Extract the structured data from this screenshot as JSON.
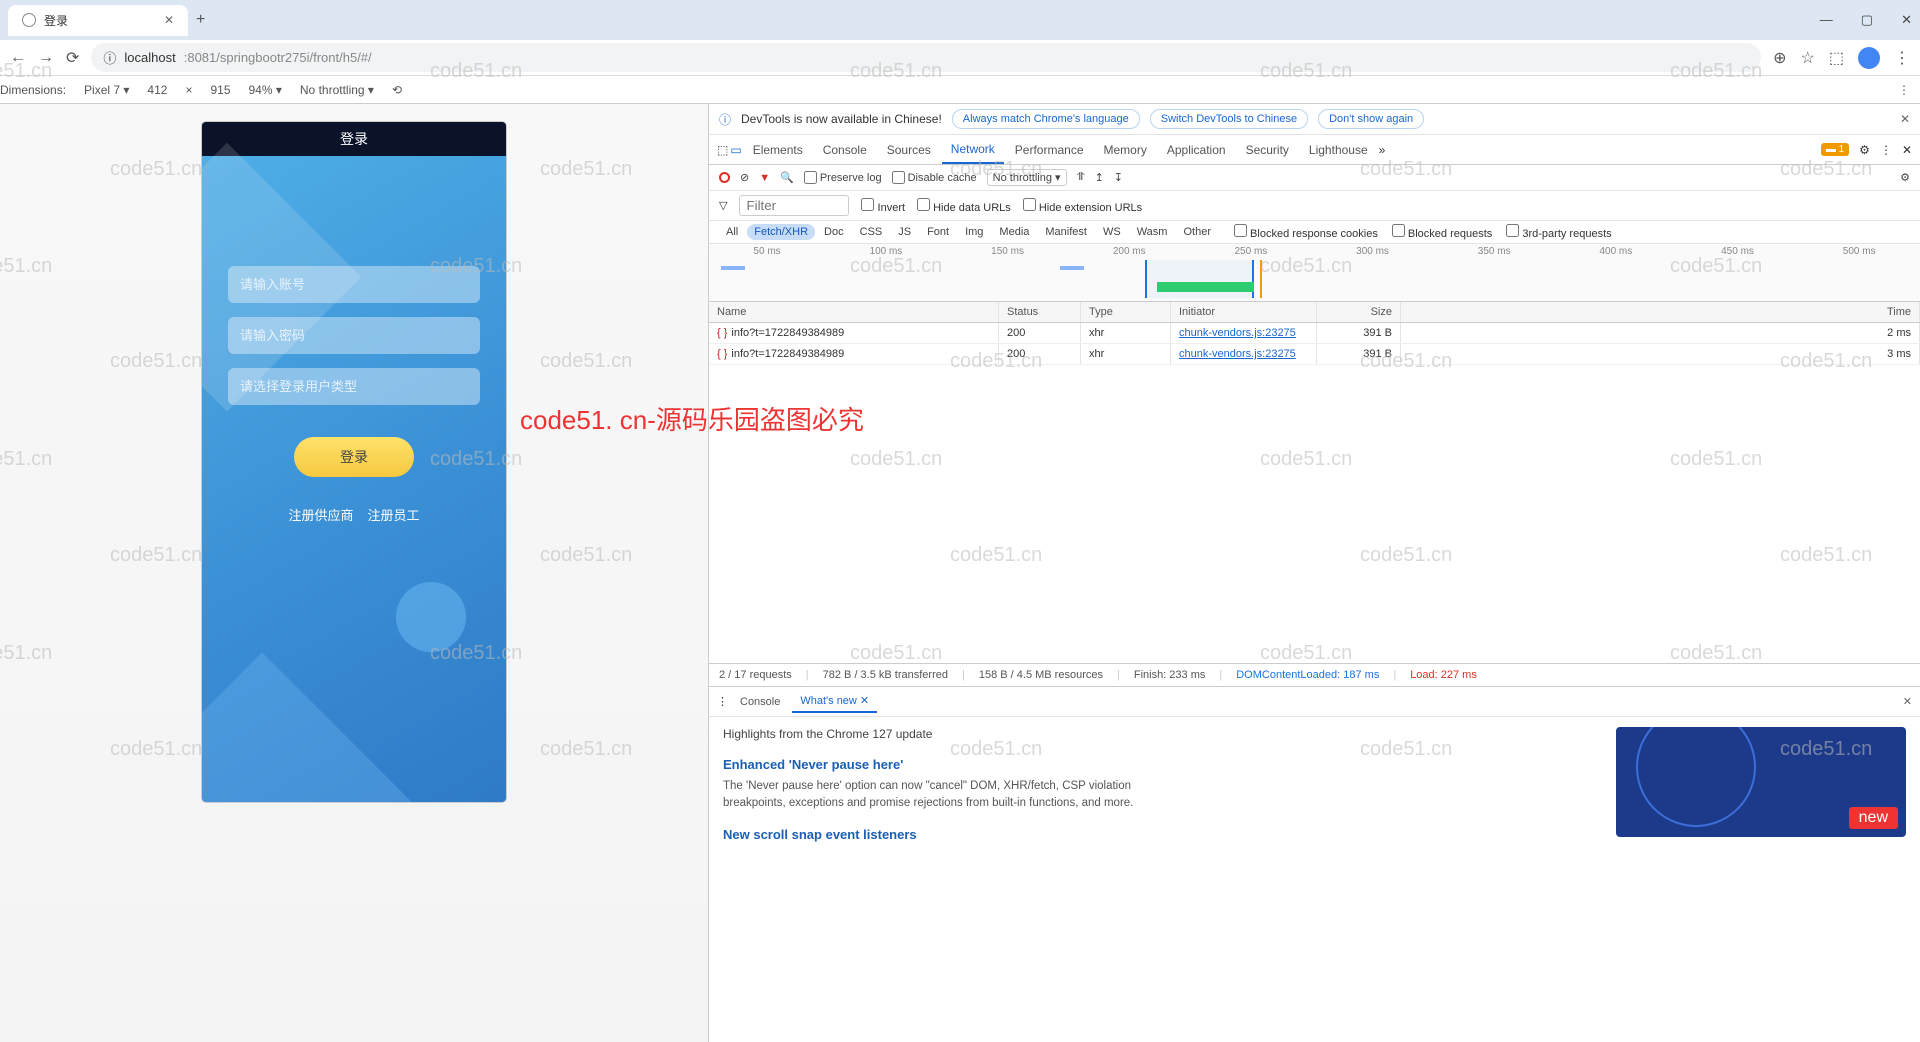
{
  "browser": {
    "tab_title": "登录",
    "url_host": "localhost",
    "url_port_path": ":8081/springbootr275i/front/h5/#/"
  },
  "device_toolbar": {
    "dimensions_label": "Dimensions:",
    "device": "Pixel 7",
    "width": "412",
    "sep": "×",
    "height": "915",
    "zoom": "94%",
    "throttling": "No throttling"
  },
  "phone": {
    "header": "登录",
    "placeholder_user": "请输入账号",
    "placeholder_pass": "请输入密码",
    "placeholder_role": "请选择登录用户类型",
    "login_btn": "登录",
    "reg_supplier": "注册供应商",
    "reg_employee": "注册员工"
  },
  "watermark_text": "code51.cn",
  "red_text": "code51. cn-源码乐园盗图必究",
  "devtools": {
    "banner_msg": "DevTools is now available in Chinese!",
    "banner_btn1": "Always match Chrome's language",
    "banner_btn2": "Switch DevTools to Chinese",
    "banner_btn3": "Don't show again",
    "tabs": [
      "Elements",
      "Console",
      "Sources",
      "Network",
      "Performance",
      "Memory",
      "Application",
      "Security",
      "Lighthouse"
    ],
    "active_tab": "Network",
    "issue_count": "1",
    "net_toolbar": {
      "preserve": "Preserve log",
      "disable_cache": "Disable cache",
      "throttling": "No throttling"
    },
    "filter_label": "Filter",
    "filter_invert": "Invert",
    "filter_hide_data": "Hide data URLs",
    "filter_hide_ext": "Hide extension URLs",
    "type_filters": [
      "All",
      "Fetch/XHR",
      "Doc",
      "CSS",
      "JS",
      "Font",
      "Img",
      "Media",
      "Manifest",
      "WS",
      "Wasm",
      "Other"
    ],
    "active_type": "Fetch/XHR",
    "blocked_cookies": "Blocked response cookies",
    "blocked_req": "Blocked requests",
    "third_party": "3rd-party requests",
    "timeline_ticks": [
      "50 ms",
      "100 ms",
      "150 ms",
      "200 ms",
      "250 ms",
      "300 ms",
      "350 ms",
      "400 ms",
      "450 ms",
      "500 ms"
    ],
    "columns": {
      "name": "Name",
      "status": "Status",
      "type": "Type",
      "initiator": "Initiator",
      "size": "Size",
      "time": "Time"
    },
    "rows": [
      {
        "name": "info?t=1722849384989",
        "status": "200",
        "type": "xhr",
        "initiator": "chunk-vendors.js:23275",
        "size": "391 B",
        "time": "2 ms"
      },
      {
        "name": "info?t=1722849384989",
        "status": "200",
        "type": "xhr",
        "initiator": "chunk-vendors.js:23275",
        "size": "391 B",
        "time": "3 ms"
      }
    ],
    "status_bar": {
      "requests": "2 / 17 requests",
      "transferred": "782 B / 3.5 kB transferred",
      "resources": "158 B / 4.5 MB resources",
      "finish": "Finish: 233 ms",
      "dcl": "DOMContentLoaded: 187 ms",
      "load": "Load: 227 ms"
    },
    "drawer": {
      "tabs": [
        "Console",
        "What's new"
      ],
      "active": "What's new",
      "highlights": "Highlights from the Chrome 127 update",
      "h1": "Enhanced 'Never pause here'",
      "p1": "The 'Never pause here' option can now \"cancel\" DOM, XHR/fetch, CSP violation breakpoints, exceptions and promise rejections from built-in functions, and more.",
      "h2": "New scroll snap event listeners",
      "promo_tag": "new"
    }
  }
}
